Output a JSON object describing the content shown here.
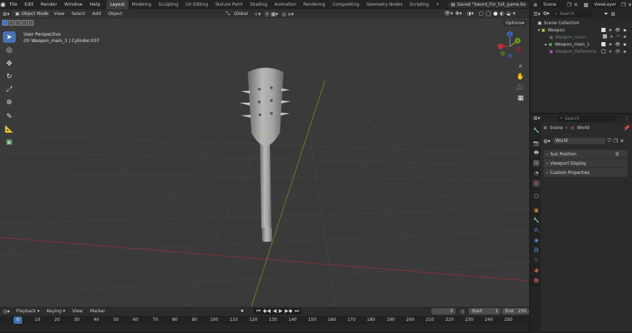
{
  "topbar": {
    "menus": [
      "File",
      "Edit",
      "Render",
      "Window",
      "Help"
    ],
    "workspaces": [
      "Layout",
      "Modeling",
      "Sculpting",
      "UV Editing",
      "Texture Paint",
      "Shading",
      "Animation",
      "Rendering",
      "Compositing",
      "Geometry Nodes",
      "Scripting"
    ],
    "active_workspace": "Layout",
    "add_tab": "+",
    "file_status": "Saved \"Sword_For_full_game.blend\"",
    "scene": "Scene",
    "view_layer": "ViewLayer"
  },
  "viewport": {
    "mode": "Object Mode",
    "menus": [
      "View",
      "Select",
      "Add",
      "Object"
    ],
    "transform": "Global",
    "overlay_title": "User Perspective",
    "overlay_object": "(0) Weapon_main_1 | Cylinder.037",
    "options": "Options",
    "gizmo": {
      "y": "Y",
      "z": "Z"
    }
  },
  "timeline": {
    "menus": [
      "Playback",
      "Keying",
      "View",
      "Marker"
    ],
    "current_frame": "0",
    "start_label": "Start",
    "start": "1",
    "end_label": "End",
    "end": "250",
    "ticks": [
      "0",
      "10",
      "20",
      "30",
      "40",
      "50",
      "60",
      "70",
      "80",
      "90",
      "100",
      "110",
      "120",
      "130",
      "140",
      "150",
      "160",
      "170",
      "180",
      "190",
      "200",
      "210",
      "220",
      "230",
      "240",
      "250"
    ]
  },
  "outliner": {
    "search_placeholder": "Search",
    "items": [
      {
        "label": "Scene Collection"
      },
      {
        "label": "Weapon"
      },
      {
        "label": "Weapon_main"
      },
      {
        "label": "Weapon_main_1"
      },
      {
        "label": "Weapon_Reference"
      }
    ]
  },
  "properties": {
    "search_placeholder": "Search",
    "breadcrumb": [
      "Scene",
      "World"
    ],
    "world_name": "World",
    "panels": [
      "Sun Position",
      "Viewport Display",
      "Custom Properties"
    ]
  },
  "colors": {
    "accent": "#4772b3",
    "x_axis": "#c0303a",
    "y_axis": "#8aa52a",
    "collection": "#d6c64b",
    "object": "#55b85a"
  }
}
